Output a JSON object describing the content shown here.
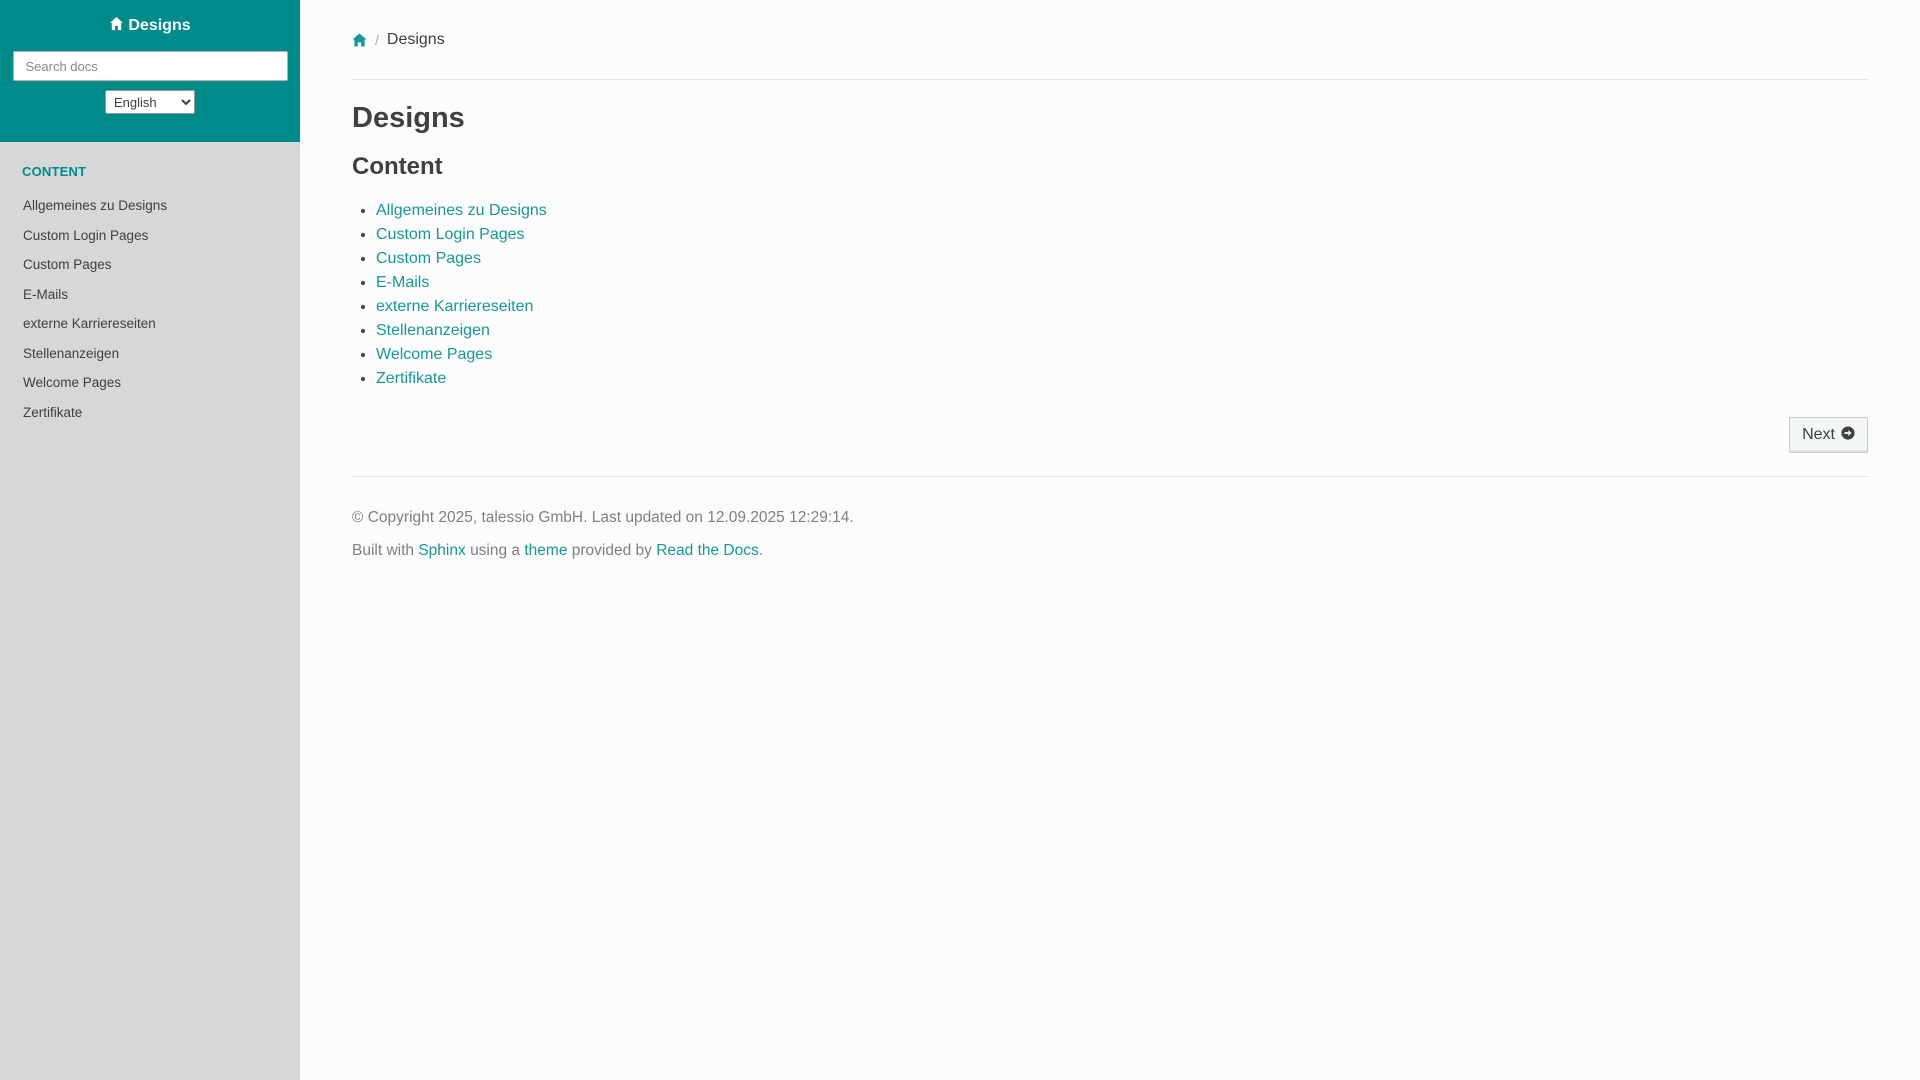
{
  "sidebar": {
    "project_title": "Designs",
    "search_placeholder": "Search docs",
    "language_selected": "English",
    "caption": "CONTENT",
    "items": [
      {
        "label": "Allgemeines zu Designs"
      },
      {
        "label": "Custom Login Pages"
      },
      {
        "label": "Custom Pages"
      },
      {
        "label": "E-Mails"
      },
      {
        "label": "externe Karriereseiten"
      },
      {
        "label": "Stellenanzeigen"
      },
      {
        "label": "Welcome Pages"
      },
      {
        "label": "Zertifikate"
      }
    ]
  },
  "breadcrumb": {
    "separator": "/",
    "current": "Designs"
  },
  "main": {
    "title": "Designs",
    "section_title": "Content",
    "toc": [
      {
        "label": "Allgemeines zu Designs"
      },
      {
        "label": "Custom Login Pages"
      },
      {
        "label": "Custom Pages"
      },
      {
        "label": "E-Mails"
      },
      {
        "label": "externe Karriereseiten"
      },
      {
        "label": "Stellenanzeigen"
      },
      {
        "label": "Welcome Pages"
      },
      {
        "label": "Zertifikate"
      }
    ],
    "next_label": "Next"
  },
  "footer": {
    "copyright": "© Copyright 2025, talessio GmbH. Last updated on 12.09.2025 12:29:14.",
    "built_with": "Built with",
    "sphinx": "Sphinx",
    "using_a": "using a",
    "theme": "theme",
    "provided_by": "provided by",
    "read_the_docs": "Read the Docs",
    "period": "."
  },
  "colors": {
    "accent": "#008b8b",
    "link": "#16989a",
    "sidebar_bg": "#d6d7d9",
    "page_bg": "#fcfcfc"
  },
  "icons": {
    "home": "home-icon",
    "next": "arrow-circle-right-icon"
  }
}
